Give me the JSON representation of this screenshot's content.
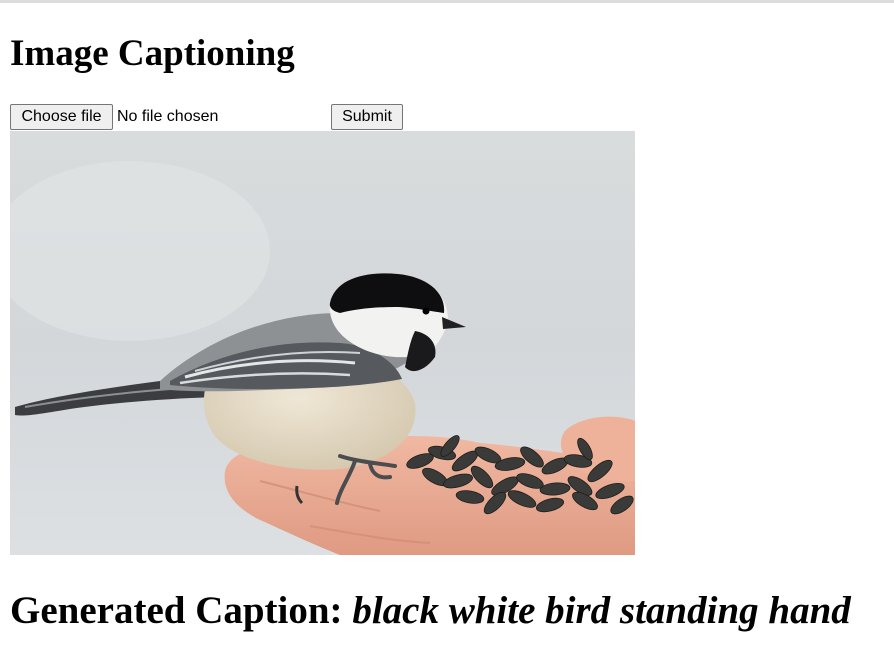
{
  "page": {
    "title": "Image Captioning"
  },
  "form": {
    "choose_file_label": "Choose file",
    "file_status": "No file chosen",
    "submit_label": "Submit"
  },
  "result": {
    "label": "Generated Caption:",
    "caption": "black white bird standing hand"
  },
  "colors": {
    "background": "#ffffff",
    "button_bg": "#efefef",
    "button_border": "#767676",
    "photo_backdrop": "#d4d9db"
  },
  "photo": {
    "subject": "chickadee-on-hand-photo"
  }
}
